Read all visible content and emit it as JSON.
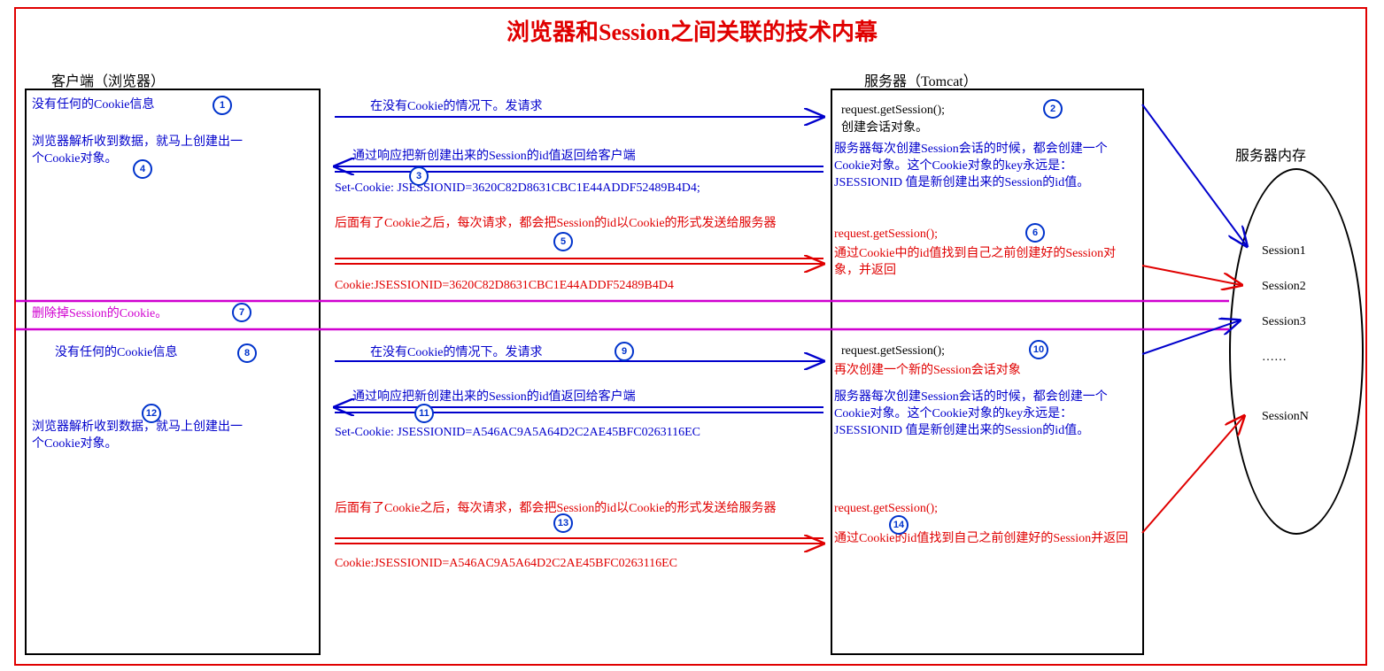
{
  "title": "浏览器和Session之间关联的技术内幕",
  "labels": {
    "client": "客户端（浏览器）",
    "server": "服务器（Tomcat）",
    "memory": "服务器内存"
  },
  "client": {
    "c1": "没有任何的Cookie信息",
    "c4": "浏览器解析收到数据，就马上创建出一个Cookie对象。",
    "c7": "删除掉Session的Cookie。",
    "c8": "没有任何的Cookie信息",
    "c12": "浏览器解析收到数据，就马上创建出一个Cookie对象。"
  },
  "arrows": {
    "a1": "在没有Cookie的情况下。发请求",
    "a3a": "通过响应把新创建出来的Session的id值返回给客户端",
    "a3b": "Set-Cookie: JSESSIONID=3620C82D8631CBC1E44ADDF52489B4D4;",
    "a5a": "后面有了Cookie之后，每次请求，都会把Session的id以Cookie的形式发送给服务器",
    "a5b": "Cookie:JSESSIONID=3620C82D8631CBC1E44ADDF52489B4D4",
    "a9": "在没有Cookie的情况下。发请求",
    "a11a": "通过响应把新创建出来的Session的id值返回给客户端",
    "a11b": "Set-Cookie: JSESSIONID=A546AC9A5A64D2C2AE45BFC0263116EC",
    "a13a": "后面有了Cookie之后，每次请求，都会把Session的id以Cookie的形式发送给服务器",
    "a13b": "Cookie:JSESSIONID=A546AC9A5A64D2C2AE45BFC0263116EC"
  },
  "server": {
    "s2a": "request.getSession();",
    "s2b": "创建会话对象。",
    "s2c": "服务器每次创建Session会话的时候，都会创建一个Cookie对象。这个Cookie对象的key永远是：JSESSIONID 值是新创建出来的Session的id值。",
    "s6a": "request.getSession();",
    "s6b": "通过Cookie中的id值找到自己之前创建好的Session对象，并返回",
    "s10a": "request.getSession();",
    "s10b": "再次创建一个新的Session会话对象",
    "s10c": "服务器每次创建Session会话的时候，都会创建一个Cookie对象。这个Cookie对象的key永远是：JSESSIONID 值是新创建出来的Session的id值。",
    "s14a": "request.getSession();",
    "s14b": "通过Cookie的id值找到自己之前创建好的Session并返回"
  },
  "memory": {
    "s1": "Session1",
    "s2": "Session2",
    "s3": "Session3",
    "dots": "……",
    "sn": "SessionN"
  },
  "badges": {
    "b1": "1",
    "b2": "2",
    "b3": "3",
    "b4": "4",
    "b5": "5",
    "b6": "6",
    "b7": "7",
    "b8": "8",
    "b9": "9",
    "b10": "10",
    "b11": "11",
    "b12": "12",
    "b13": "13",
    "b14": "14"
  }
}
